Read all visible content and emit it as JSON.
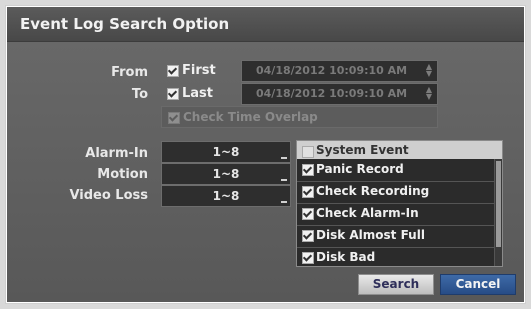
{
  "dialog": {
    "title": "Event Log Search Option"
  },
  "time_range": {
    "from_label": "From",
    "to_label": "To",
    "first_label": "First",
    "last_label": "Last",
    "first_checked": true,
    "last_checked": true,
    "from_datetime": "04/18/2012 10:09:10 AM",
    "to_datetime": "04/18/2012 10:09:10 AM",
    "overlap_label": "Check Time Overlap",
    "overlap_checked": true
  },
  "channels": {
    "alarm_in_label": "Alarm-In",
    "alarm_in_value": "1~8",
    "motion_label": "Motion",
    "motion_value": "1~8",
    "video_loss_label": "Video Loss",
    "video_loss_value": "1~8"
  },
  "system_event": {
    "header_label": "System Event",
    "header_checked": false,
    "items": [
      {
        "label": "Panic Record",
        "checked": true
      },
      {
        "label": "Check Recording",
        "checked": true
      },
      {
        "label": "Check Alarm-In",
        "checked": true
      },
      {
        "label": "Disk Almost Full",
        "checked": true
      },
      {
        "label": "Disk Bad",
        "checked": true
      }
    ]
  },
  "buttons": {
    "search_label": "Search",
    "cancel_label": "Cancel"
  },
  "colors": {
    "dialog_bg": "#5f5f5f",
    "field_bg": "#2e2e2e",
    "cancel_button": "#2f5c98",
    "search_button": "#d6d6d6"
  }
}
